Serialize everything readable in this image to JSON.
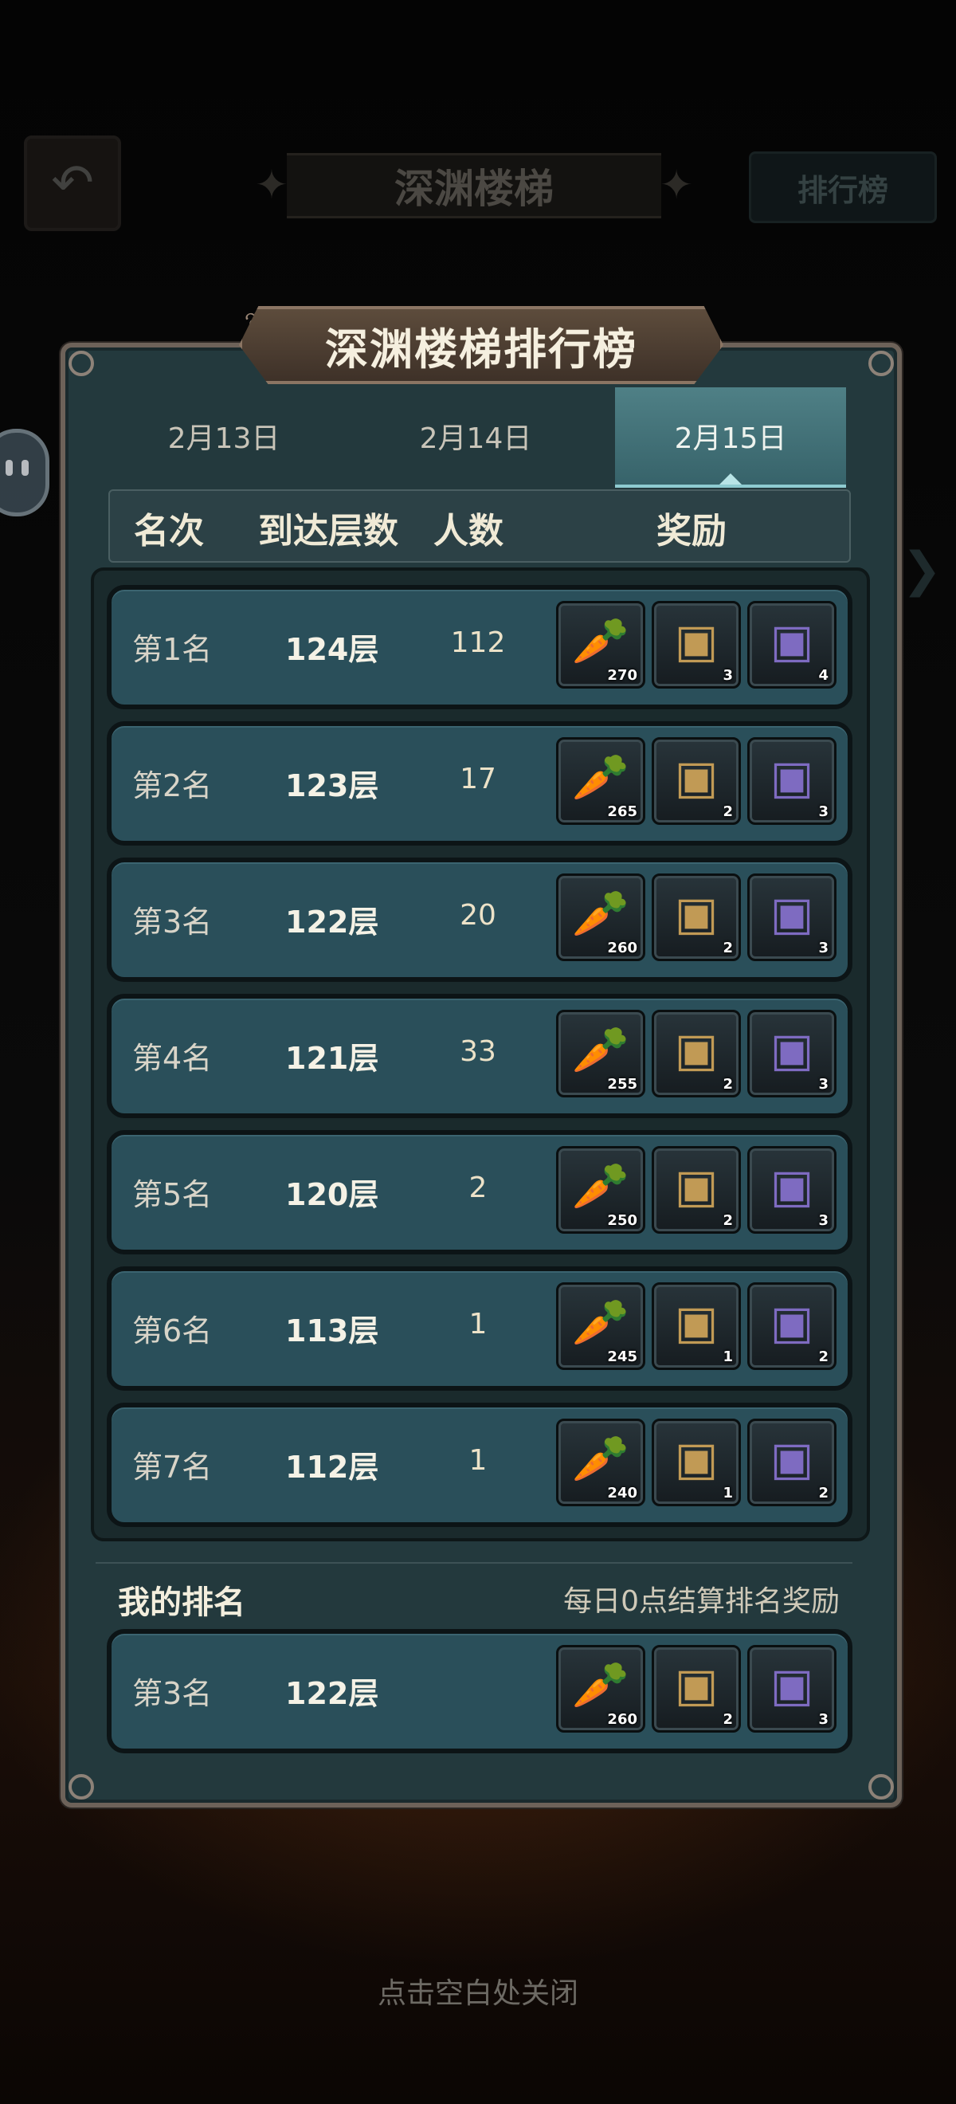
{
  "scene": {
    "title": "深渊楼梯",
    "rank_button": "排行榜"
  },
  "panel": {
    "title": "深渊楼梯排行榜",
    "tabs": [
      {
        "label": "2月13日",
        "active": false
      },
      {
        "label": "2月14日",
        "active": false
      },
      {
        "label": "2月15日",
        "active": true
      }
    ],
    "columns": {
      "rank": "名次",
      "floor": "到达层数",
      "people": "人数",
      "reward": "奖励"
    },
    "rows": [
      {
        "rank": "第1名",
        "floor": "124层",
        "people": "112",
        "rewards": [
          "270",
          "3",
          "4"
        ]
      },
      {
        "rank": "第2名",
        "floor": "123层",
        "people": "17",
        "rewards": [
          "265",
          "2",
          "3"
        ]
      },
      {
        "rank": "第3名",
        "floor": "122层",
        "people": "20",
        "rewards": [
          "260",
          "2",
          "3"
        ]
      },
      {
        "rank": "第4名",
        "floor": "121层",
        "people": "33",
        "rewards": [
          "255",
          "2",
          "3"
        ]
      },
      {
        "rank": "第5名",
        "floor": "120层",
        "people": "2",
        "rewards": [
          "250",
          "2",
          "3"
        ]
      },
      {
        "rank": "第6名",
        "floor": "113层",
        "people": "1",
        "rewards": [
          "245",
          "1",
          "2"
        ]
      },
      {
        "rank": "第7名",
        "floor": "112层",
        "people": "1",
        "rewards": [
          "240",
          "1",
          "2"
        ]
      }
    ],
    "reward_icons": [
      "carrot-icon",
      "treasure-chest-icon",
      "purple-chest-icon"
    ],
    "my_rank": {
      "label": "我的排名",
      "settle_note": "每日0点结算排名奖励",
      "rank": "第3名",
      "floor": "122层",
      "rewards": [
        "260",
        "2",
        "3"
      ]
    }
  },
  "close_tip": "点击空白处关闭"
}
